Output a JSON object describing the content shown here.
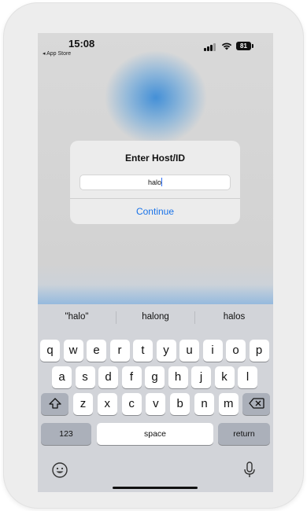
{
  "status_bar": {
    "time": "15:08",
    "back_app": "◂ App Store",
    "battery": "81"
  },
  "dialog": {
    "title": "Enter Host/ID",
    "input_value": "halo",
    "continue_label": "Continue"
  },
  "keyboard": {
    "suggestions": [
      "\"halo\"",
      "halong",
      "halos"
    ],
    "row1": [
      "q",
      "w",
      "e",
      "r",
      "t",
      "y",
      "u",
      "i",
      "o",
      "p"
    ],
    "row2": [
      "a",
      "s",
      "d",
      "f",
      "g",
      "h",
      "j",
      "k",
      "l"
    ],
    "row3": [
      "z",
      "x",
      "c",
      "v",
      "b",
      "n",
      "m"
    ],
    "numbers_label": "123",
    "space_label": "space",
    "return_label": "return"
  },
  "icons": {
    "shift": "shift-icon",
    "delete": "backspace-icon",
    "emoji": "emoji-icon",
    "mic": "microphone-icon"
  },
  "colors": {
    "accent": "#1a73e8",
    "keyboard_bg": "#d2d4d9",
    "dark_key": "#abb0ba"
  }
}
